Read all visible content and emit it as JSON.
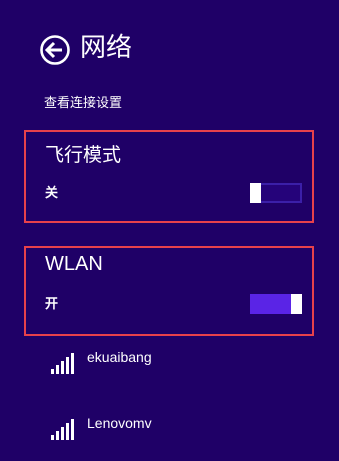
{
  "header": {
    "title": "网络",
    "back_icon": "back-arrow-circle-icon"
  },
  "view_connection_settings": "查看连接设置",
  "airplane_mode": {
    "title": "飞行模式",
    "state_label": "关",
    "enabled": false
  },
  "wlan": {
    "title": "WLAN",
    "state_label": "开",
    "enabled": true
  },
  "networks": [
    {
      "name": "ekuaibang",
      "icon": "wifi-signal-icon"
    },
    {
      "name": "Lenovomv",
      "icon": "wifi-signal-icon"
    }
  ],
  "colors": {
    "background": "#1f0067",
    "highlight_box": "#e8414b",
    "toggle_on": "#5a24e6",
    "toggle_off_track": "#25037a"
  }
}
